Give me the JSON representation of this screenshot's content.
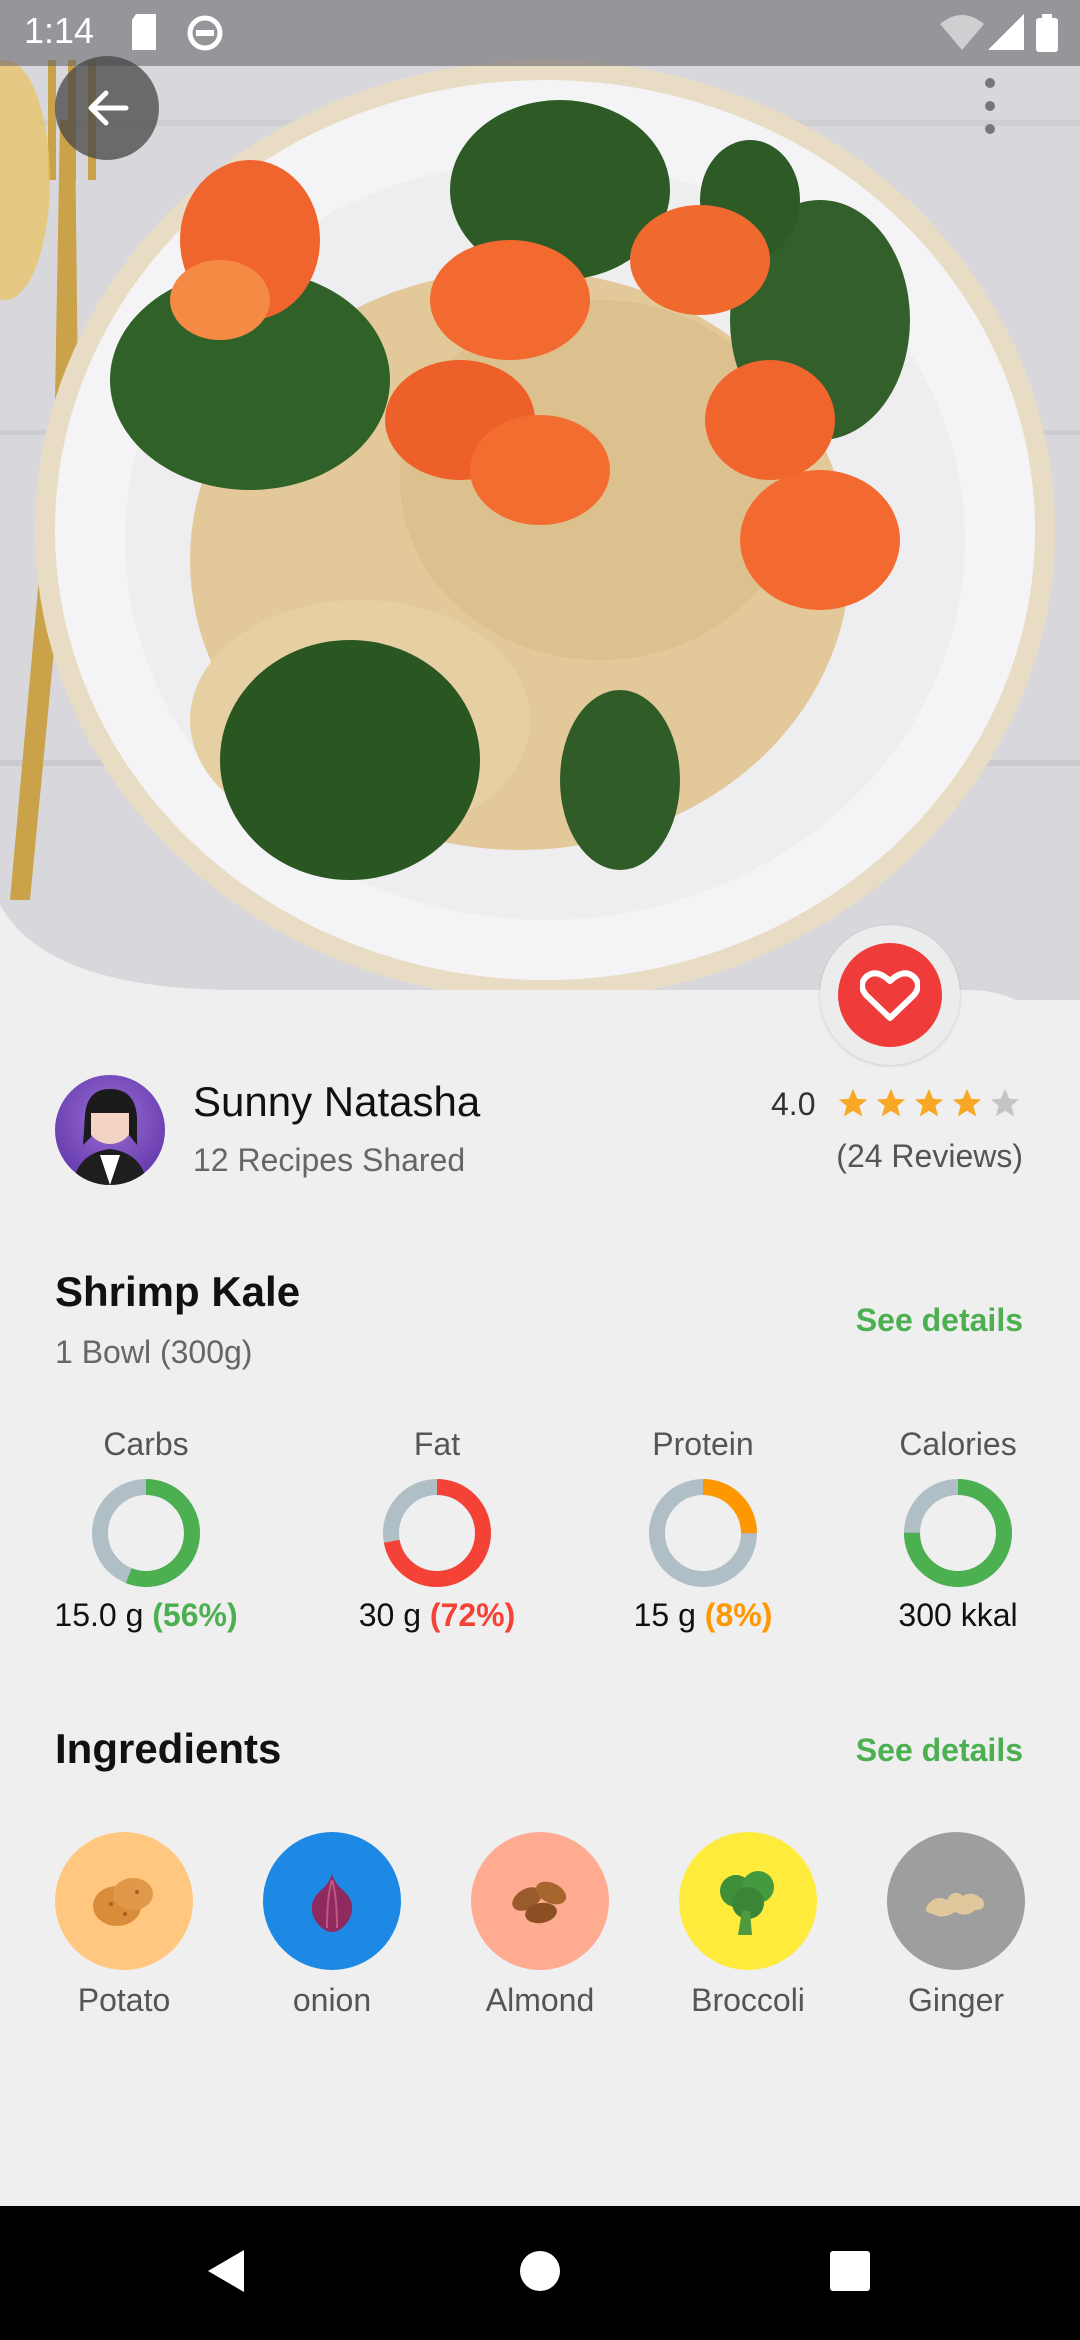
{
  "status_bar": {
    "time": "1:14"
  },
  "author": {
    "name": "Sunny Natasha",
    "subtitle": "12 Recipes Shared"
  },
  "rating": {
    "value": "4.0",
    "stars": 4,
    "max_stars": 5,
    "reviews": "(24 Reviews)"
  },
  "dish": {
    "title": "Shrimp Kale",
    "serving": "1 Bowl (300g)",
    "see_details": "See details"
  },
  "nutrition": [
    {
      "label": "Carbs",
      "amount": "15.0 g",
      "percent": "(56%)",
      "fraction": 0.56,
      "color": "#4caf50"
    },
    {
      "label": "Fat",
      "amount": "30 g",
      "percent": "(72%)",
      "fraction": 0.72,
      "color": "#f44336"
    },
    {
      "label": "Protein",
      "amount": "15 g",
      "percent": "(8%)",
      "fraction": 0.25,
      "color": "#ff9800"
    },
    {
      "label": "Calories",
      "amount": "300 kkal",
      "percent": "",
      "fraction": 0.75,
      "color": "#4caf50"
    }
  ],
  "ingredients_section": {
    "title": "Ingredients",
    "see_details": "See details"
  },
  "ingredients": [
    {
      "name": "Potato",
      "icon": "potato-icon",
      "bg": "#ffc77f"
    },
    {
      "name": "onion",
      "icon": "onion-icon",
      "bg": "#1e88e5"
    },
    {
      "name": "Almond",
      "icon": "almond-icon",
      "bg": "#ffab91"
    },
    {
      "name": "Broccoli",
      "icon": "broccoli-icon",
      "bg": "#ffeb3b"
    },
    {
      "name": "Ginger",
      "icon": "ginger-icon",
      "bg": "#9e9e9e"
    }
  ],
  "colors": {
    "accent_green": "#4caf50",
    "favorite_red": "#ef3b39",
    "star": "#f9a825",
    "ring_track": "#b0bec5"
  }
}
